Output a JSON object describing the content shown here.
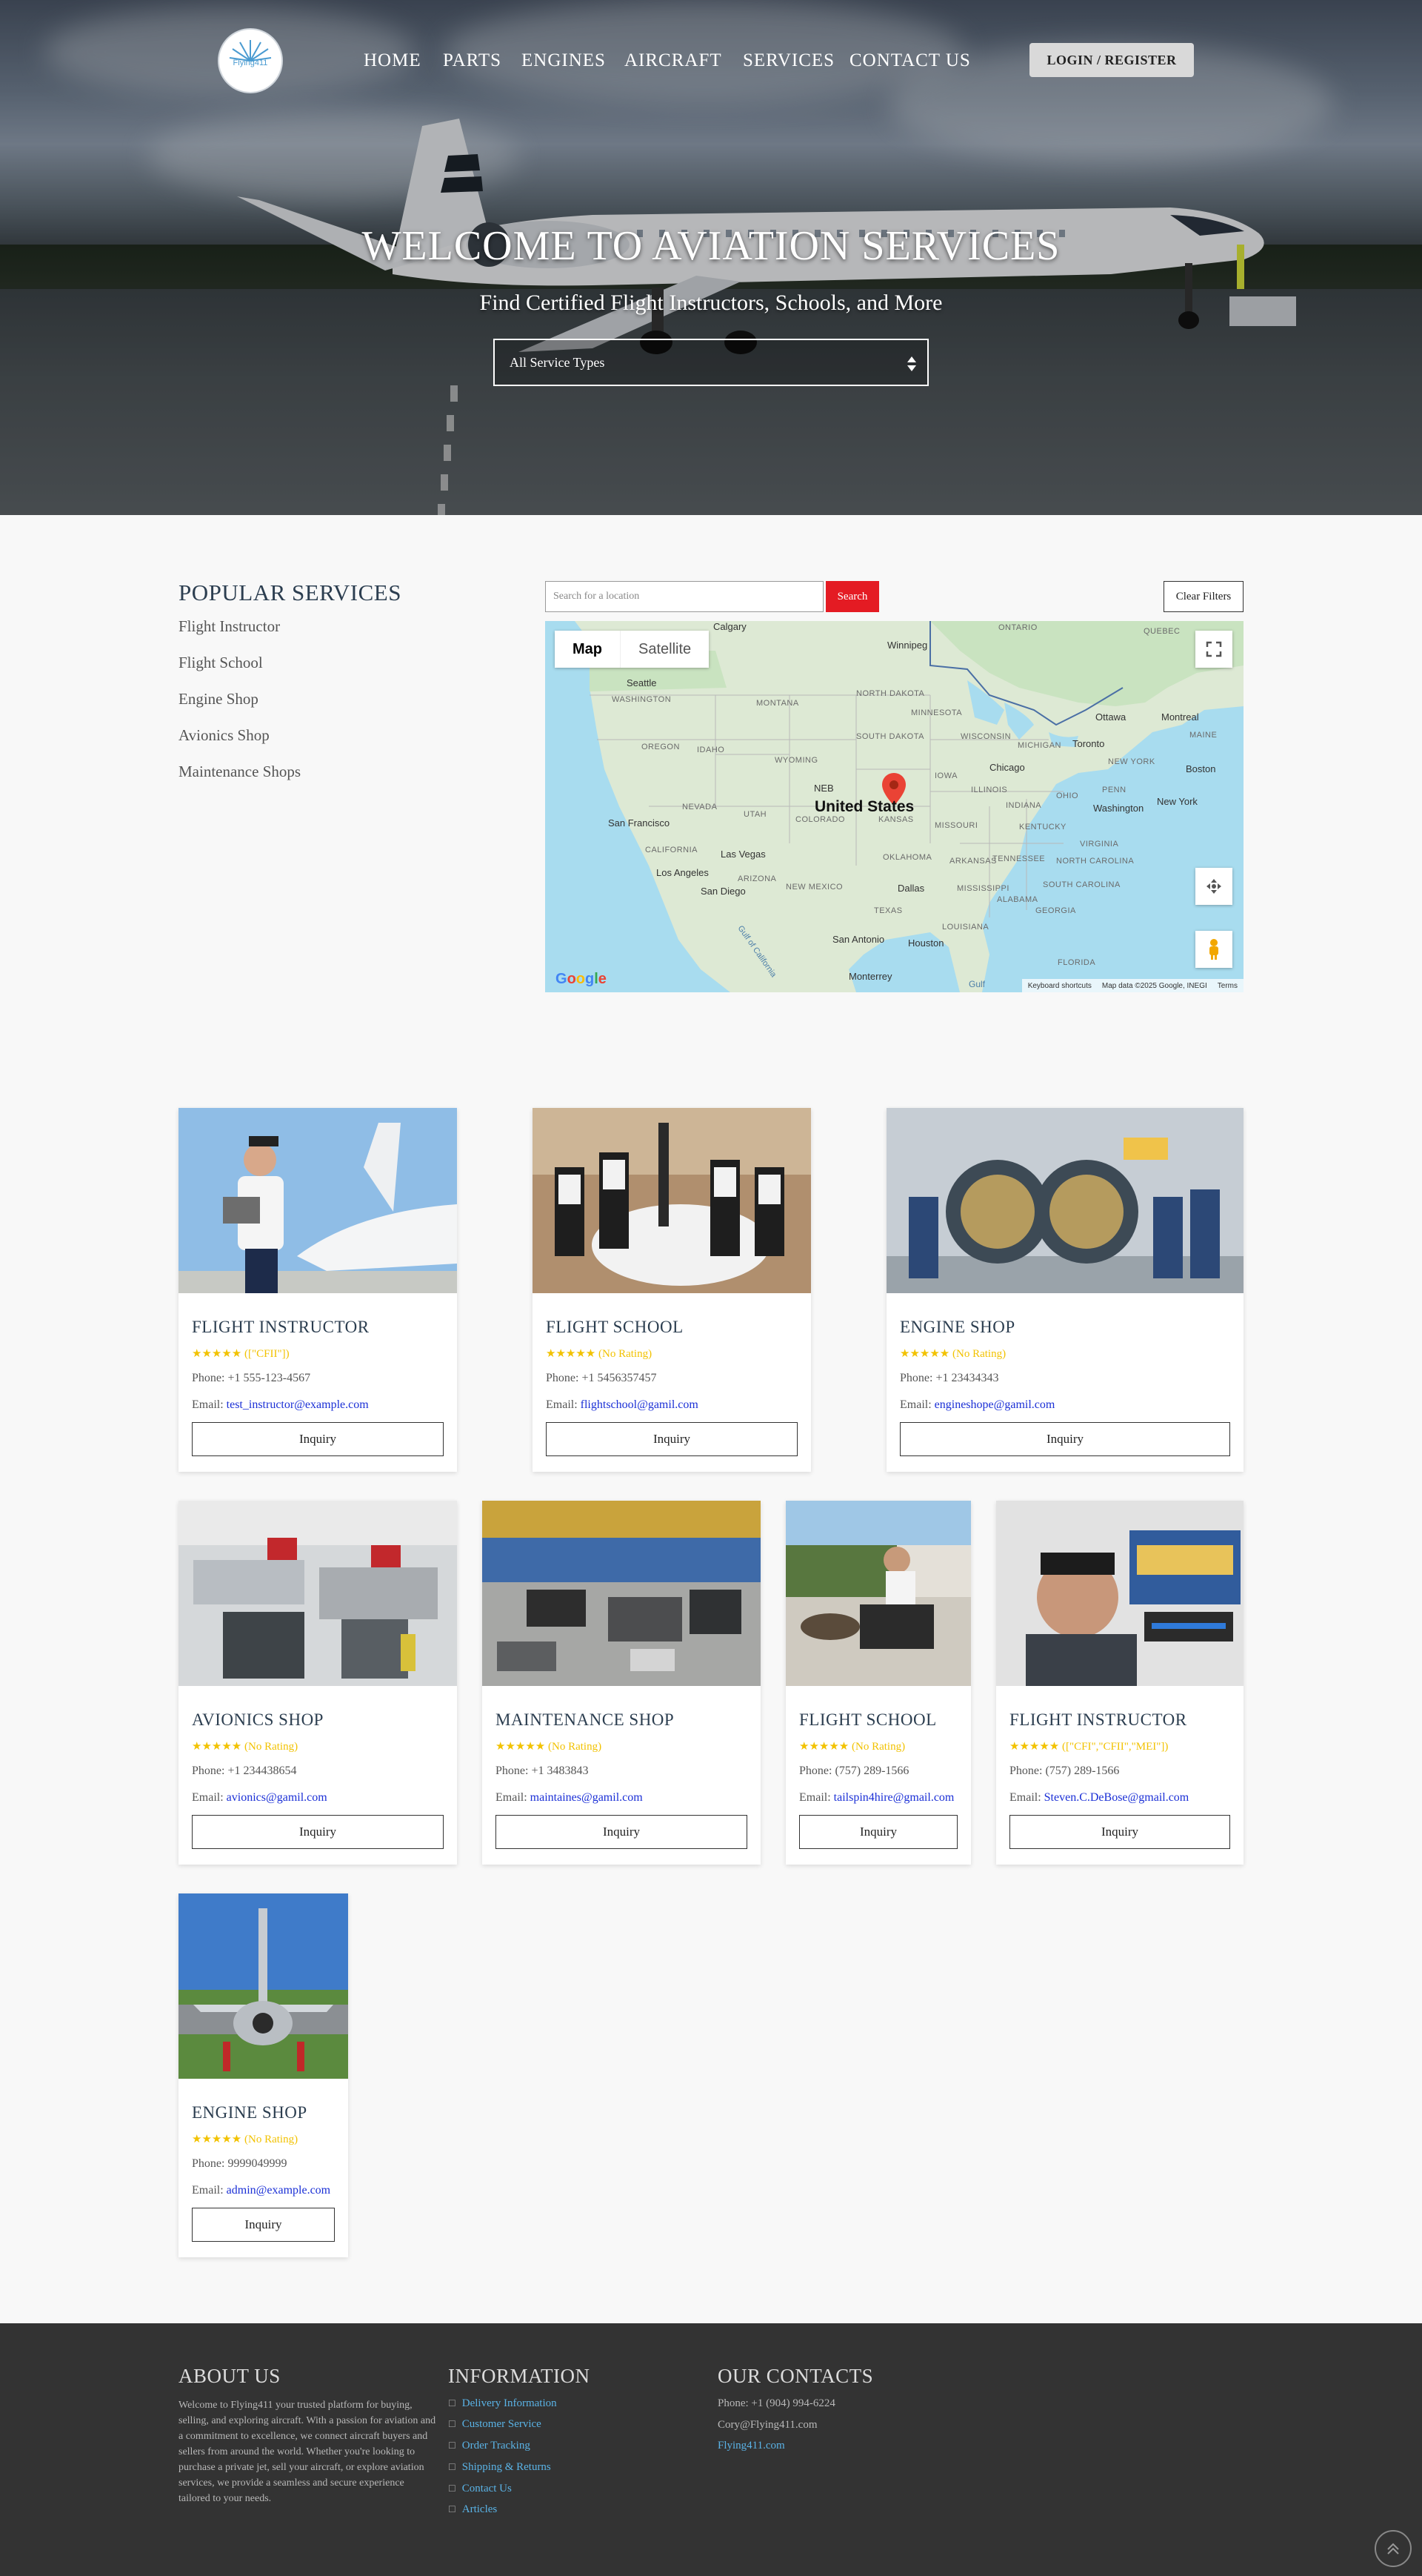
{
  "header": {
    "logo_text": "Flying411",
    "nav": [
      "HOME",
      "PARTS",
      "ENGINES",
      "AIRCRAFT",
      "SERVICES",
      "CONTACT US"
    ],
    "login_label": "LOGIN / REGISTER"
  },
  "hero": {
    "title": "WELCOME TO AVIATION SERVICES",
    "subtitle": "Find Certified Flight Instructors, Schools, and More",
    "select_value": "All Service Types"
  },
  "sidebar": {
    "title": "POPULAR SERVICES",
    "items": [
      "Flight Instructor",
      "Flight School",
      "Engine Shop",
      "Avionics Shop",
      "Maintenance Shops"
    ]
  },
  "map": {
    "search_placeholder": "Search for a location",
    "search_label": "Search",
    "clear_label": "Clear Filters",
    "tabs": [
      "Map",
      "Satellite"
    ],
    "marker_label": "United States",
    "labels": {
      "calgary": "Calgary",
      "winnipeg": "Winnipeg",
      "ontario": "ONTARIO",
      "quebec": "QUEBEC",
      "seattle": "Seattle",
      "washington_st": "WASHINGTON",
      "montana": "MONTANA",
      "north_dakota": "NORTH DAKOTA",
      "minnesota": "MINNESOTA",
      "oregon": "OREGON",
      "idaho": "IDAHO",
      "south_dakota": "SOUTH DAKOTA",
      "wisconsin": "WISCONSIN",
      "michigan": "MICHIGAN",
      "ottawa": "Ottawa",
      "montreal": "Montreal",
      "wyoming": "WYOMING",
      "toronto": "Toronto",
      "maine": "MAINE",
      "new_york_st": "NEW YORK",
      "iowa": "IOWA",
      "chicago": "Chicago",
      "boston": "Boston",
      "nevada": "NEVADA",
      "utah": "UTAH",
      "illinois": "ILLINOIS",
      "indiana": "INDIANA",
      "ohio": "OHIO",
      "penn": "PENN",
      "washington": "Washington",
      "new_york": "New York",
      "san_francisco": "San Francisco",
      "colorado": "COLORADO",
      "kansas": "KANSAS",
      "missouri": "MISSOURI",
      "kentucky": "KENTUCKY",
      "virginia": "VIRGINIA",
      "california": "CALIFORNIA",
      "las_vegas": "Las Vegas",
      "oklahoma": "OKLAHOMA",
      "arkansas": "ARKANSAS",
      "tennessee": "TENNESSEE",
      "north_carolina": "NORTH CAROLINA",
      "los_angeles": "Los Angeles",
      "arizona": "ARIZONA",
      "new_mexico": "NEW MEXICO",
      "san_diego": "San Diego",
      "dallas": "Dallas",
      "mississippi": "MISSISSIPPI",
      "alabama": "ALABAMA",
      "south_carolina": "SOUTH CAROLINA",
      "georgia": "GEORGIA",
      "texas": "TEXAS",
      "louisiana": "LOUISIANA",
      "san_antonio": "San Antonio",
      "houston": "Houston",
      "florida": "FLORIDA",
      "monterrey": "Monterrey",
      "gulf_of_california": "Gulf of California",
      "gulf": "Gulf"
    },
    "footer": [
      "Keyboard shortcuts",
      "Map data ©2025 Google, INEGI",
      "Terms"
    ],
    "google": "Google"
  },
  "cards": [
    {
      "title": "FLIGHT INSTRUCTOR",
      "stars": "★★★★★",
      "rating": "([\"CFII\"])",
      "phone": "Phone: +1 555-123-4567",
      "email_label": "Email:",
      "email": "test_instructor@example.com",
      "button": "Inquiry"
    },
    {
      "title": "FLIGHT SCHOOL",
      "stars": "★★★★★",
      "rating": "(No Rating)",
      "phone": "Phone: +1 5456357457",
      "email_label": "Email:",
      "email": "flightschool@gamil.com",
      "button": "Inquiry"
    },
    {
      "title": "ENGINE SHOP",
      "stars": "★★★★★",
      "rating": "(No Rating)",
      "phone": "Phone: +1 23434343",
      "email_label": "Email:",
      "email": "engineshope@gamil.com",
      "button": "Inquiry"
    },
    {
      "title": "AVIONICS SHOP",
      "stars": "★★★★★",
      "rating": "(No Rating)",
      "phone": "Phone: +1 234438654",
      "email_label": "Email:",
      "email": "avionics@gamil.com",
      "button": "Inquiry"
    },
    {
      "title": "MAINTENANCE SHOP",
      "stars": "★★★★★",
      "rating": "(No Rating)",
      "phone": "Phone: +1 3483843",
      "email_label": "Email:",
      "email": "maintaines@gamil.com",
      "button": "Inquiry"
    },
    {
      "title": "FLIGHT SCHOOL",
      "stars": "★★★★★",
      "rating": "(No Rating)",
      "phone": "Phone: (757) 289-1566",
      "email_label": "Email:",
      "email": "tailspin4hire@gmail.com",
      "button": "Inquiry"
    },
    {
      "title": "FLIGHT INSTRUCTOR",
      "stars": "★★★★★",
      "rating": "([\"CFI\",\"CFII\",\"MEI\"])",
      "phone": "Phone: (757) 289-1566",
      "email_label": "Email:",
      "email": "Steven.C.DeBose@gmail.com",
      "button": "Inquiry"
    },
    {
      "title": "ENGINE SHOP",
      "stars": "★★★★★",
      "rating": "(No Rating)",
      "phone": "Phone: 9999049999",
      "email_label": "Email:",
      "email": "admin@example.com",
      "button": "Inquiry"
    }
  ],
  "footer": {
    "about_title": "ABOUT US",
    "about_text": "Welcome to Flying411 your trusted platform for buying, selling, and exploring aircraft. With a passion for aviation and a commitment to excellence, we connect aircraft buyers and sellers from around the world. Whether you're looking to purchase a private jet, sell your aircraft, or explore aviation services, we provide a seamless and secure experience tailored to your needs.",
    "info_title": "INFORMATION",
    "info_items": [
      "Delivery Information",
      "Customer Service",
      "Order Tracking",
      "Shipping & Returns",
      "Contact Us",
      "Articles"
    ],
    "contacts_title": "OUR CONTACTS",
    "phone": "Phone: +1 (904) 994-6224",
    "email": "Cory@Flying411.com",
    "site": "Flying411.com"
  },
  "colors": {
    "accent_red": "#e41b23",
    "star": "#f2c200",
    "link_blue": "#1a2fd6",
    "footer_bg": "#333333",
    "footer_link": "#5ab3e6"
  }
}
